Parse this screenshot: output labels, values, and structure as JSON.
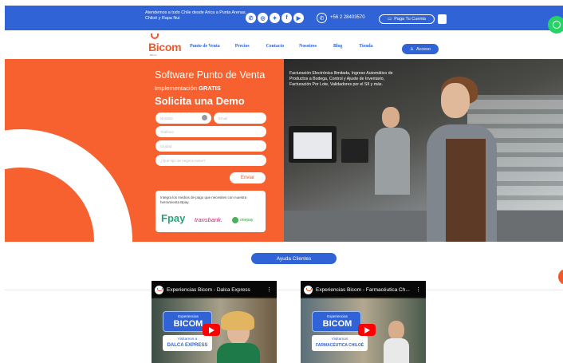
{
  "topbar": {
    "attention": "Atendemos a todo Chile desde Arica a Punta Arenas, Chiloé y Rapa Nui",
    "social_icons": [
      "whatsapp-icon",
      "instagram-icon",
      "twitter-icon",
      "facebook-icon",
      "youtube-icon"
    ],
    "phone": "+56 2 28403570",
    "pay_account": "Paga Tu Cuenta",
    "cart_icon": "cart-icon"
  },
  "nav": {
    "logo": "Bicom",
    "logo_tagline": "Bicom",
    "items": [
      "Punto de Venta",
      "Precios",
      "Contacto",
      "Nosotros",
      "Blog",
      "Tienda"
    ],
    "login": "Acceso"
  },
  "hero": {
    "title": "Software Punto de Venta",
    "implementation_prefix": "Implementación",
    "implementation_bold": "GRATIS",
    "cta": "Solicita una Demo",
    "fields": {
      "name": "Nombre",
      "email": "Email",
      "phone": "Teléfono",
      "city": "Ciudad",
      "business": "¿Qué tipo de negocio tiene?"
    },
    "send": "Enviar",
    "payment_text": "Integra los medios de pago que necesites con nuestra herramienta Bpay.",
    "payment_logos": [
      "Fpay",
      "transbank.",
      "onepay"
    ],
    "photo_caption": "Facturación Electrónica Ilimitada, Ingreso Automático de Productos a Bodega, Control y Ajuste de Inventario, Facturación Por Lote, Validadores por el SII y más."
  },
  "help": {
    "label": "Ayuda Clientes"
  },
  "videos": [
    {
      "title": "Experiencias Bicom - Dalca Express",
      "badge_top": "Experiencias",
      "badge_main": "BICOM",
      "sub1": "Visitamos a",
      "sub2": "DALCA EXPRESS"
    },
    {
      "title": "Experiencias Bicom - Farmacéutica Ch...",
      "badge_top": "Experiencias",
      "badge_main": "BICOM",
      "sub1": "Visitamos",
      "sub2": "FARMACÉUTICA CHILOÉ"
    }
  ],
  "colors": {
    "brand_blue": "#2f63d6",
    "brand_orange": "#f7612f",
    "whatsapp": "#25d366"
  }
}
